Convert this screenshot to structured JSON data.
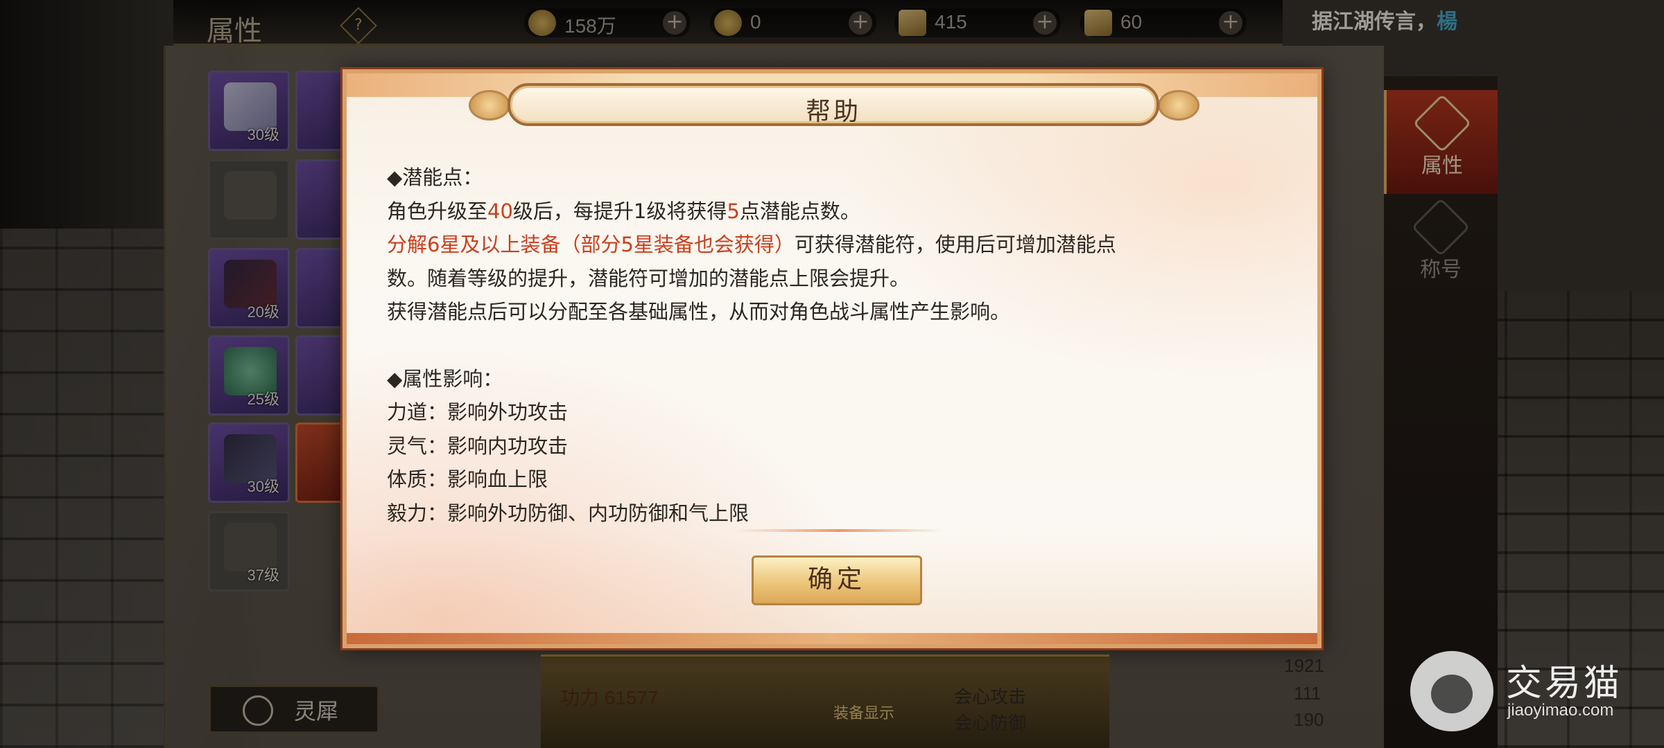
{
  "topbar": {
    "title": "属性",
    "help_glyph": "?",
    "resources": [
      {
        "icon": "coin-icon",
        "value": "158万"
      },
      {
        "icon": "gold-ingot-icon",
        "value": "0"
      },
      {
        "icon": "scroll-icon",
        "value": "415"
      },
      {
        "icon": "scroll-icon",
        "value": "60"
      }
    ],
    "plus_glyph": "+",
    "rumor_prefix": "据江湖传言，",
    "rumor_name": "楊"
  },
  "equipment": [
    {
      "level": "30级"
    },
    {
      "level": ""
    },
    {
      "level": "20级"
    },
    {
      "level": "25级"
    },
    {
      "level": "30级"
    },
    {
      "level": "37级"
    }
  ],
  "left_button": {
    "label": "灵犀"
  },
  "bottom": {
    "power": "功力 61577",
    "equip_display": "装备显示",
    "stats": [
      {
        "name": "会心攻击",
        "value": "111"
      },
      {
        "name": "会心防御",
        "value": "190"
      }
    ],
    "extra_value": "1921"
  },
  "right_tabs": [
    {
      "label": "属性",
      "active": true
    },
    {
      "label": "称号",
      "active": false
    }
  ],
  "dialog": {
    "title": "帮助",
    "section1_heading": "◆潜能点：",
    "line1": {
      "a": "角色升级至",
      "b": "40",
      "c": "级后，每提升1级将获得",
      "d": "5",
      "e": "点潜能点数。"
    },
    "line2": {
      "a": "分解",
      "b": "6星及以上装备（部分5星装备也会获得）",
      "c": "可获得潜能符，使用后可增加潜能点"
    },
    "line3": "数。随着等级的提升，潜能符可增加的潜能点上限会提升。",
    "line4": "获得潜能点后可以分配至各基础属性，从而对角色战斗属性产生影响。",
    "section2_heading": "◆属性影响：",
    "effects": [
      "力道：影响外功攻击",
      "灵气：影响内功攻击",
      "体质：影响血上限",
      "毅力：影响外功防御、内功防御和气上限"
    ],
    "confirm_label": "确定"
  },
  "watermark": {
    "brand": "交易猫",
    "domain": "jiaoyimao.com"
  }
}
